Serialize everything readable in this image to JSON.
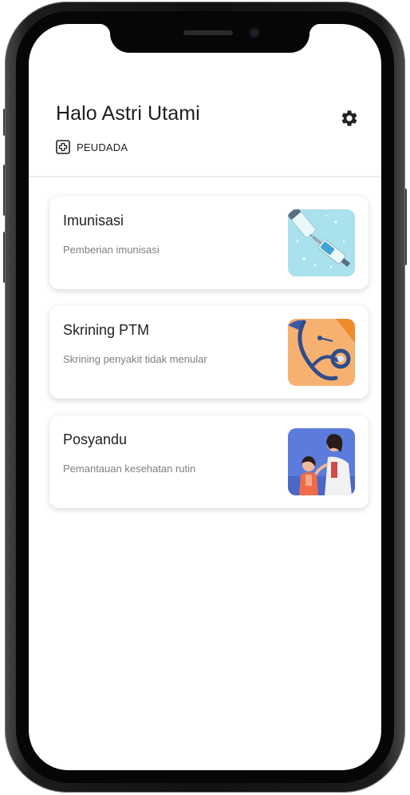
{
  "header": {
    "greeting": "Halo Astri Utami",
    "facility": "PEUDADA"
  },
  "icons": {
    "settings": "gear-icon",
    "facility": "hospital-plus-icon"
  },
  "colors": {
    "imunisasi_bg": "#a9e1ec",
    "skrining_bg": "#f6b171",
    "posyandu_bg": "#5b7bdd"
  },
  "menu": [
    {
      "title": "Imunisasi",
      "description": "Pemberian imunisasi"
    },
    {
      "title": "Skrining PTM",
      "description": "Skrining penyakit tidak menular"
    },
    {
      "title": "Posyandu",
      "description": "Pemantauan kesehatan rutin"
    }
  ]
}
